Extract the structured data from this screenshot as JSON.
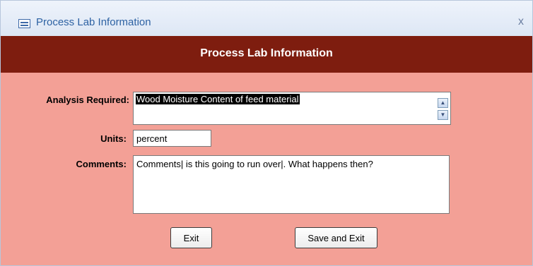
{
  "window": {
    "title": "Process Lab Information",
    "close_glyph": "x",
    "icon": "form-icon"
  },
  "header": {
    "title": "Process Lab Information",
    "color": "#7e1d0f"
  },
  "form": {
    "background": "#f3a096",
    "analysis": {
      "label": "Analysis Required:",
      "value": "Wood Moisture Content of feed material"
    },
    "units": {
      "label": "Units:",
      "value": "percent"
    },
    "comments": {
      "label": "Comments:",
      "value": "Comments| is this going to run over|. What happens then?"
    }
  },
  "buttons": {
    "exit": "Exit",
    "save_exit": "Save and Exit"
  }
}
